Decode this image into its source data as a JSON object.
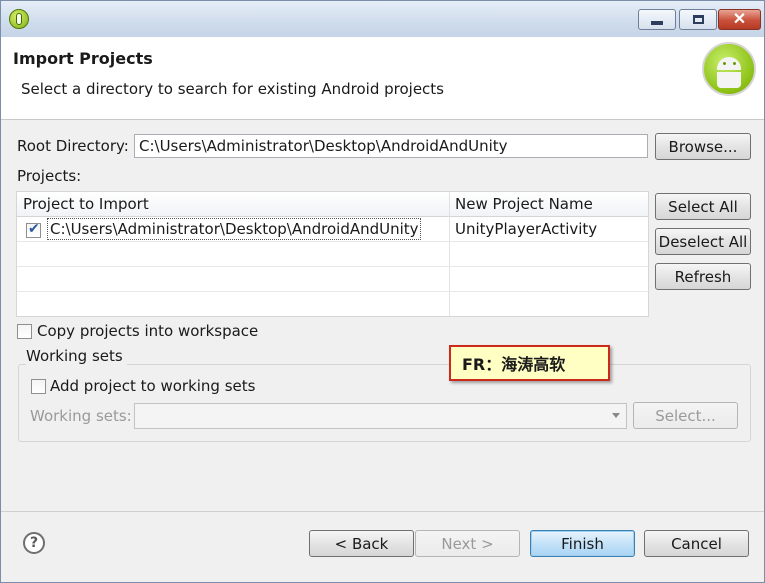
{
  "window": {
    "title_icons": [
      "app-icon"
    ],
    "controls": {
      "minimize": "minimize-icon",
      "maximize": "maximize-icon",
      "close": "close-icon"
    }
  },
  "header": {
    "title": "Import Projects",
    "description": "Select a directory to search for existing Android projects",
    "logo": "android-logo"
  },
  "root_directory": {
    "label": "Root Directory:",
    "value": "C:\\Users\\Administrator\\Desktop\\AndroidAndUnity",
    "browse_label": "Browse..."
  },
  "projects": {
    "label": "Projects:",
    "columns": [
      "Project to Import",
      "New Project Name"
    ],
    "rows": [
      {
        "checked": true,
        "path": "C:\\Users\\Administrator\\Desktop\\AndroidAndUnity",
        "name": "UnityPlayerActivity"
      }
    ],
    "buttons": {
      "select_all": "Select All",
      "deselect_all": "Deselect All",
      "refresh": "Refresh"
    }
  },
  "options": {
    "copy_label": "Copy projects into workspace",
    "copy_checked": false
  },
  "working_sets": {
    "group_title": "Working sets",
    "add_label": "Add project to working sets",
    "add_checked": false,
    "field_label": "Working sets:",
    "field_value": "",
    "select_label": "Select..."
  },
  "watermark": {
    "text": "FR：海涛高软"
  },
  "footer": {
    "back_label": "< Back",
    "next_label": "Next >",
    "finish_label": "Finish",
    "cancel_label": "Cancel"
  },
  "colors": {
    "accent": "#3c7fb1",
    "watermark_border": "#cc2a1a",
    "watermark_bg": "#ffffc4"
  }
}
